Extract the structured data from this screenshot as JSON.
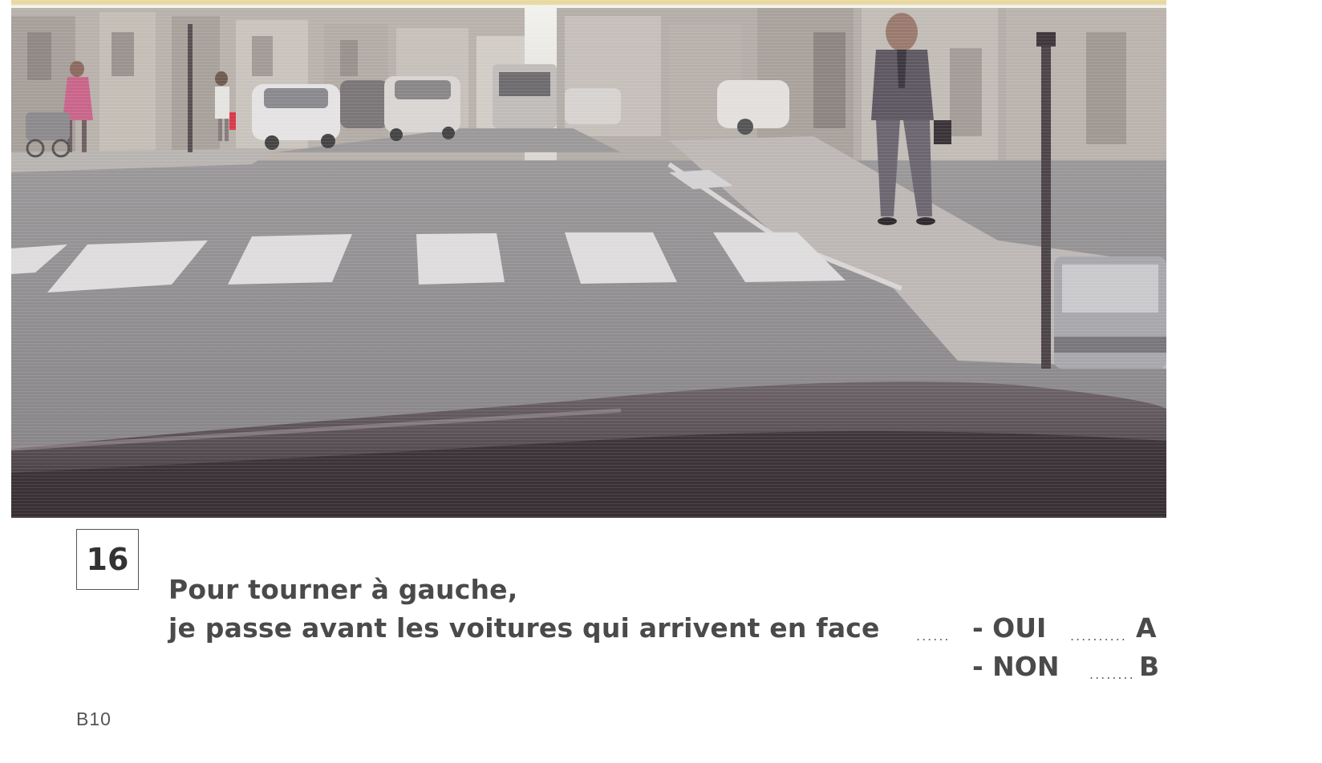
{
  "question": {
    "number": "16",
    "line1": "Pour tourner à gauche,",
    "line2": "je passe avant les voitures qui arrivent en face",
    "lead_dots": "......"
  },
  "answers": [
    {
      "label": "- OUI",
      "dots": "..........",
      "letter": "A"
    },
    {
      "label": "- NON",
      "dots": "........",
      "letter": "B"
    }
  ],
  "page_ref": "B10",
  "photo": {
    "subject": "street-scene-from-driver-seat"
  },
  "colors": {
    "road": "#8d8a8e",
    "crosswalk": "#dedcdd",
    "dashboard": "#4b4248",
    "text": "#4a4a4a"
  }
}
